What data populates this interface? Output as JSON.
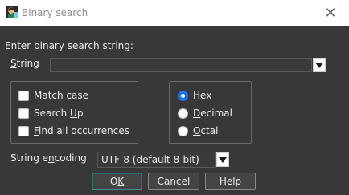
{
  "window": {
    "title": "Binary search",
    "close_glyph": "✕"
  },
  "search": {
    "prompt": "Enter binary search string:",
    "string_label_accel": "S",
    "string_label_rest": "tring",
    "value": ""
  },
  "options": {
    "match_case": {
      "pre": "Match ",
      "accel": "c",
      "post": "ase",
      "checked": false
    },
    "search_up": {
      "pre": "Search ",
      "accel": "U",
      "post": "p",
      "checked": false
    },
    "find_all": {
      "pre": "",
      "accel": "F",
      "post": "ind all occurrences",
      "checked": false
    }
  },
  "mode": {
    "selected": "Hex",
    "hex": {
      "pre": "",
      "accel": "H",
      "post": "ex"
    },
    "decimal": {
      "pre": "",
      "accel": "D",
      "post": "ecimal"
    },
    "octal": {
      "pre": "",
      "accel": "O",
      "post": "ctal"
    }
  },
  "encoding": {
    "label_pre": "String e",
    "label_accel": "n",
    "label_post": "coding",
    "value": "UTF-8 (default 8-bit)"
  },
  "buttons": {
    "ok": {
      "pre": "O",
      "accel": "K",
      "post": ""
    },
    "cancel": "Cancel",
    "help": "Help"
  },
  "colors": {
    "background": "#383838",
    "titlebar": "#ffffff",
    "radio_accent": "#1a73e8",
    "default_button_border": "#4a8a8a"
  },
  "icons": {
    "app": "app-logo-icon",
    "close": "close-icon",
    "dropdown": "chevron-down-icon"
  }
}
